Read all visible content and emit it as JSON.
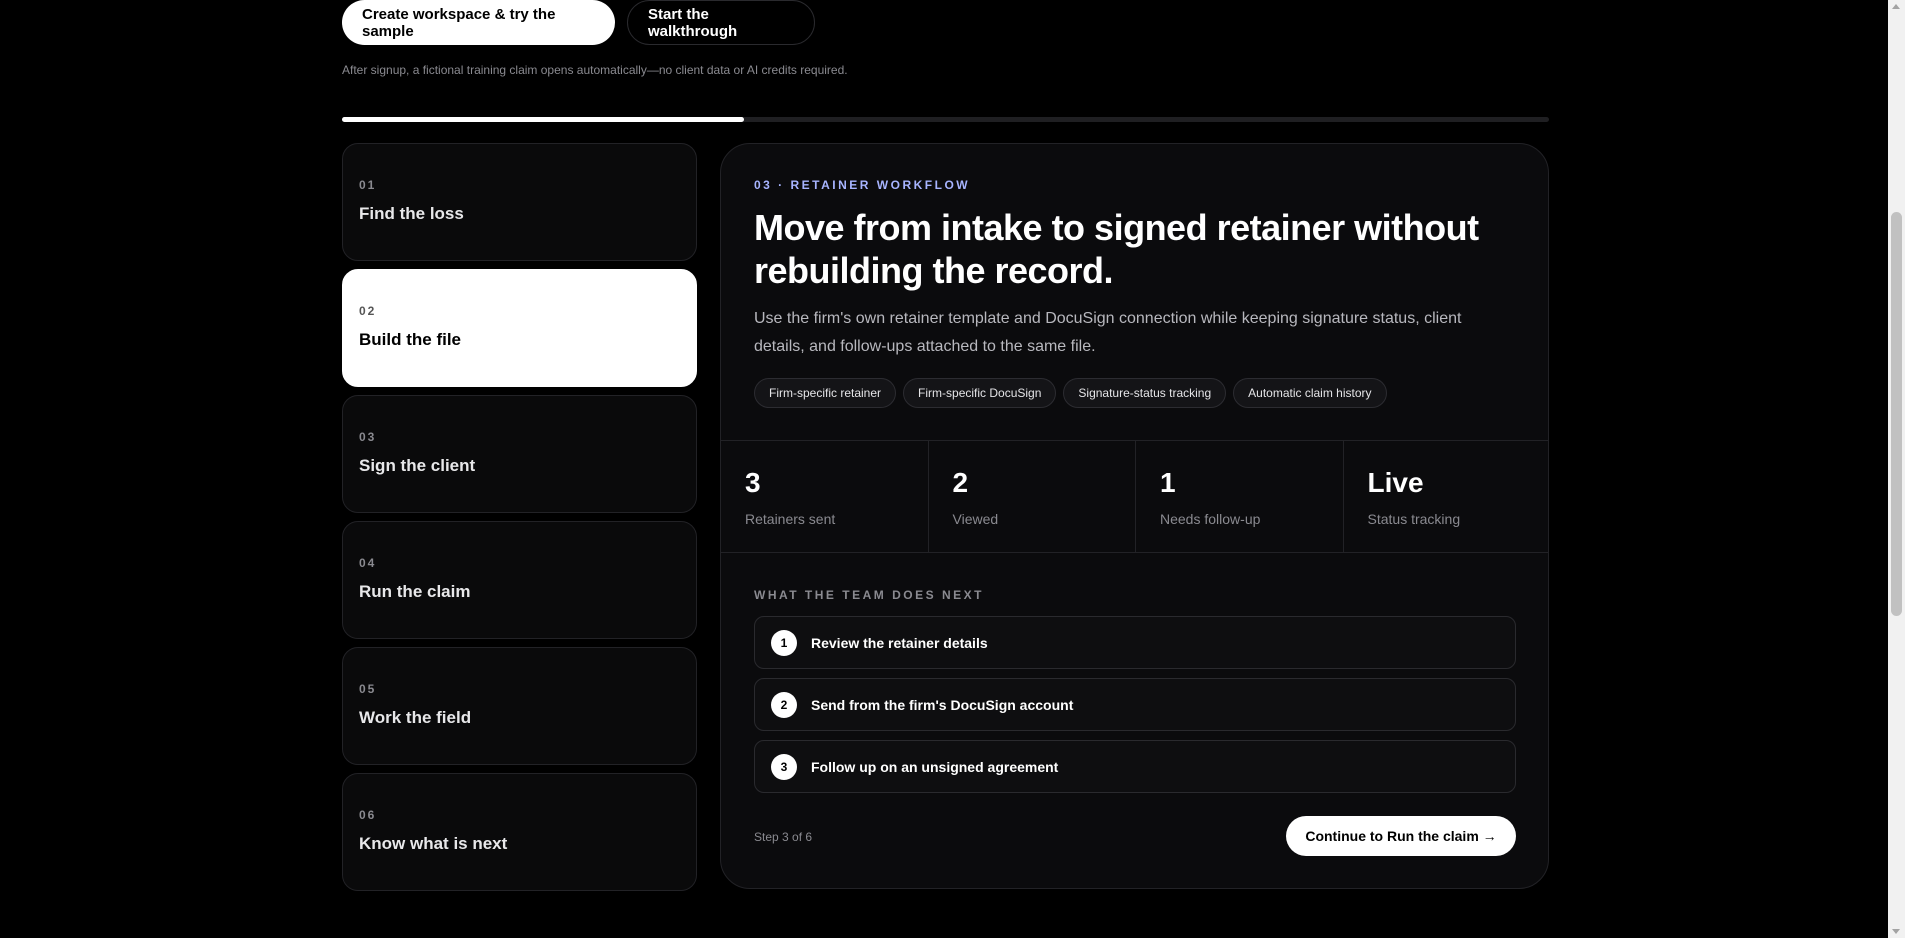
{
  "cta": {
    "primary_label": "Create workspace & try the sample",
    "secondary_label": "Start the walkthrough",
    "note": "After signup, a fictional training claim opens automatically—no client data or AI credits required."
  },
  "progress": {
    "fraction": 0.333
  },
  "steps": [
    {
      "num": "01",
      "title": "Find the loss"
    },
    {
      "num": "02",
      "title": "Build the file"
    },
    {
      "num": "03",
      "title": "Sign the client"
    },
    {
      "num": "04",
      "title": "Run the claim"
    },
    {
      "num": "05",
      "title": "Work the field"
    },
    {
      "num": "06",
      "title": "Know what is next"
    }
  ],
  "panel": {
    "eyebrow": "03 · RETAINER WORKFLOW",
    "headline": "Move from intake to signed retainer without rebuilding the record.",
    "description": "Use the firm's own retainer template and DocuSign connection while keeping signature status, client details, and follow-ups attached to the same file.",
    "tags": [
      "Firm-specific retainer",
      "Firm-specific DocuSign",
      "Signature-status tracking",
      "Automatic claim history"
    ],
    "stats": [
      {
        "value": "3",
        "label": "Retainers sent"
      },
      {
        "value": "2",
        "label": "Viewed"
      },
      {
        "value": "1",
        "label": "Needs follow-up"
      },
      {
        "value": "Live",
        "label": "Status tracking"
      }
    ],
    "next_title": "WHAT THE TEAM DOES NEXT",
    "tasks": [
      {
        "num": "1",
        "label": "Review the retainer details"
      },
      {
        "num": "2",
        "label": "Send from the firm's DocuSign account"
      },
      {
        "num": "3",
        "label": "Follow up on an unsigned agreement"
      }
    ],
    "step_count": "Step 3 of 6",
    "continue_label": "Continue to Run the claim →"
  },
  "colors": {
    "accent": "#a7b4ff",
    "background": "#000000",
    "panel": "#0b0b0d"
  }
}
